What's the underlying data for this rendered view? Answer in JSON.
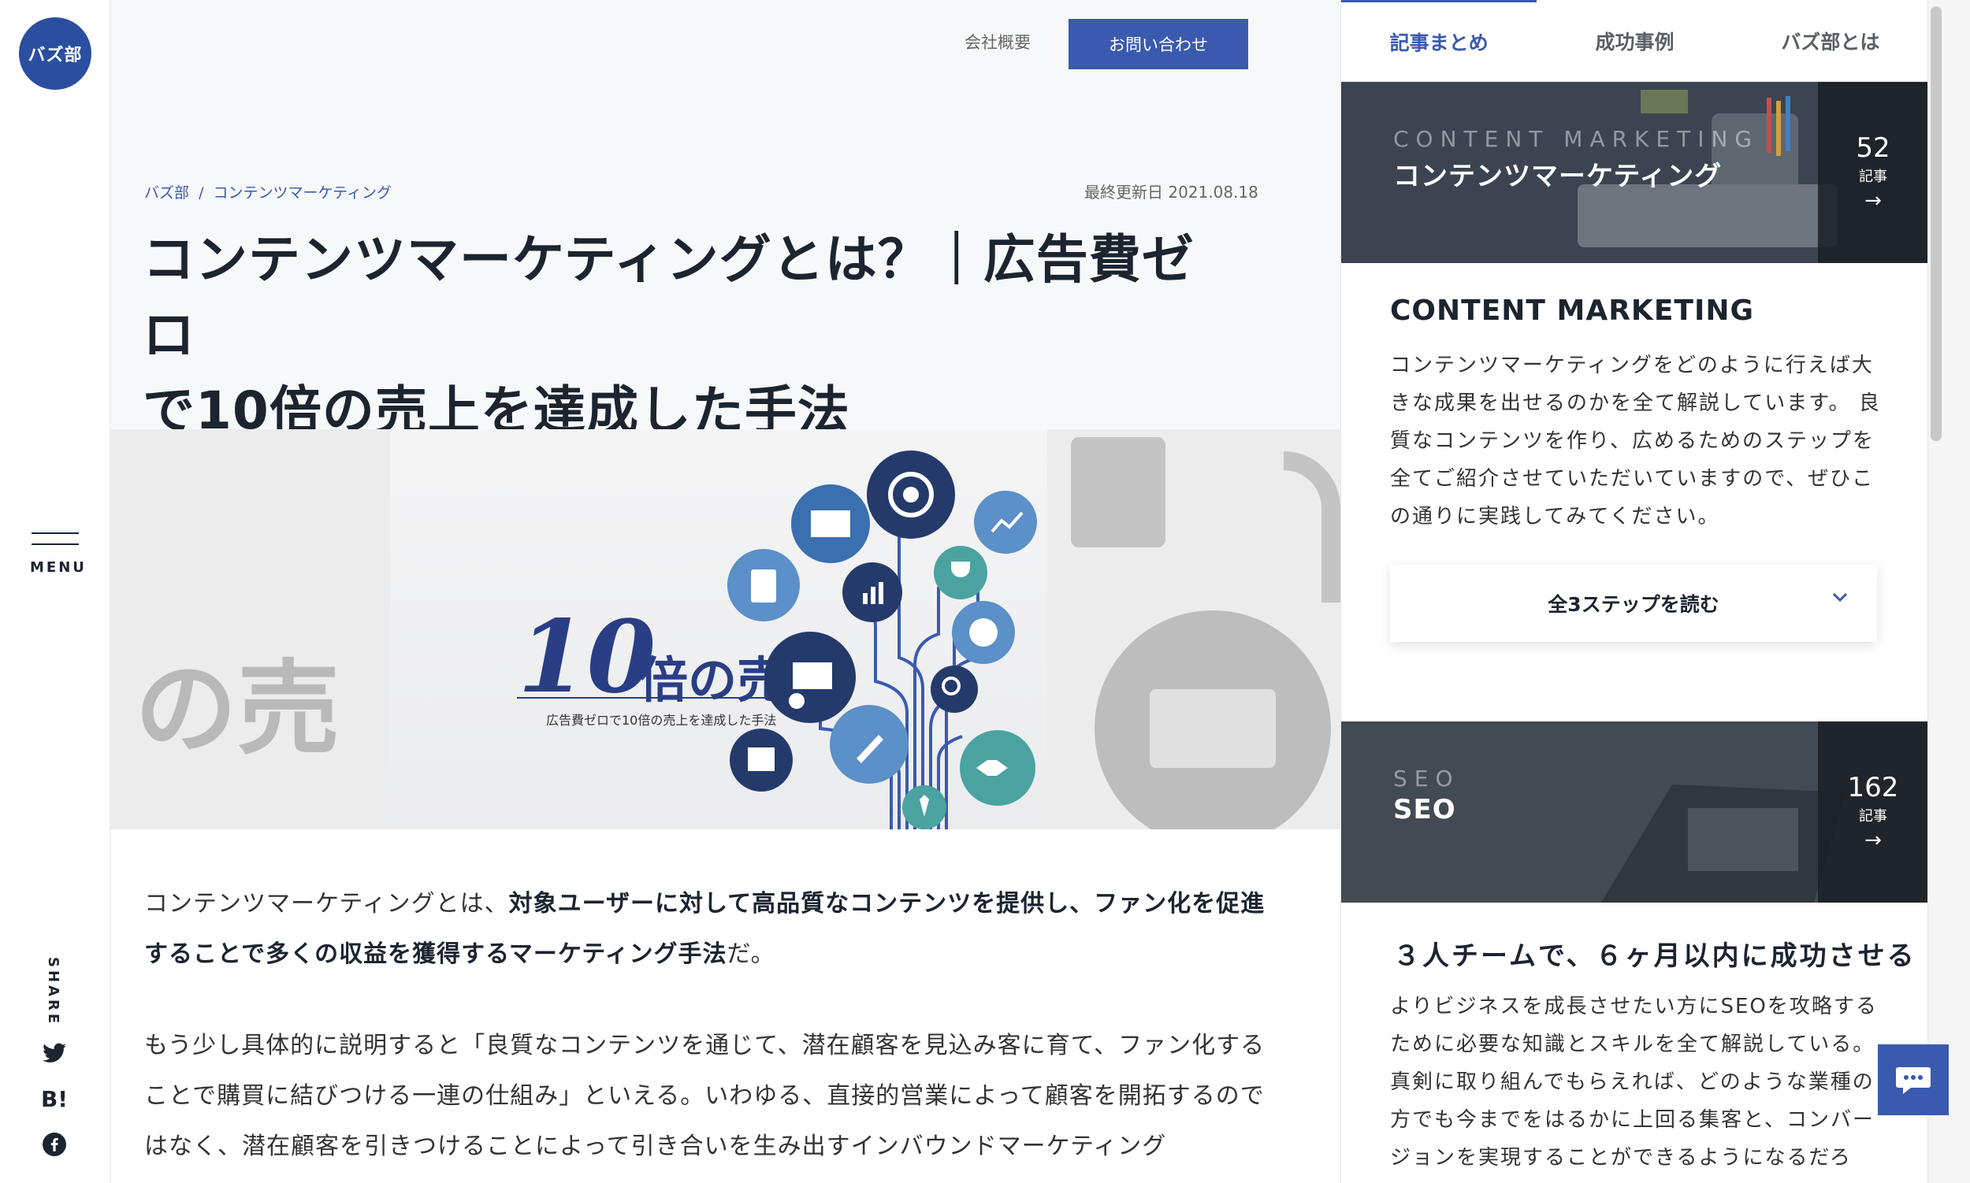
{
  "logo": {
    "text": "バズ部"
  },
  "left_rail": {
    "menu_label": "MENU",
    "share_label": "SHARE",
    "share_icons": [
      "twitter-icon",
      "hatena-bookmark-icon",
      "facebook-icon"
    ],
    "hatena_text": "B!"
  },
  "header": {
    "company_link": "会社概要",
    "contact_button": "お問い合わせ"
  },
  "breadcrumb": {
    "home": "バズ部",
    "separator": "/",
    "category": "コンテンツマーケティング"
  },
  "article": {
    "updated": "最終更新日 2021.08.18",
    "title_line1": "コンテンツマーケティングとは？｜広告費ゼロ",
    "title_line2": "で10倍の売上を達成した手法",
    "hero": {
      "big_number": "10",
      "big_text": "倍の売上",
      "caption": "広告費ゼロで10倍の売上を達成した手法",
      "ghost_text": "の売"
    },
    "para1_a": "コンテンツマーケティングとは、",
    "para1_b": "対象ユーザーに対して高品質なコンテンツを提供し、ファン化を促進することで多くの収益を獲得するマーケティング手法",
    "para1_c": "だ。",
    "para2": "もう少し具体的に説明すると「良質なコンテンツを通じて、潜在顧客を見込み客に育て、ファン化することで購買に結びつける一連の仕組み」といえる。いわゆる、直接的営業によって顧客を開拓するのではなく、潜在顧客を引きつけることによって引き合いを生み出すインバウンドマーケティング"
  },
  "sidebar": {
    "tabs": [
      {
        "label": "記事まとめ",
        "active": true
      },
      {
        "label": "成功事例",
        "active": false
      },
      {
        "label": "バズ部とは",
        "active": false
      }
    ],
    "category1": {
      "en": "CONTENT MARKETING",
      "ja": "コンテンツマーケティング",
      "count": "52",
      "unit": "記事",
      "arrow": "→"
    },
    "cat_heading": "CONTENT MARKETING",
    "cat_desc": "コンテンツマーケティングをどのように行えば大きな成果を出せるのかを全て解説しています。 良質なコンテンツを作り、広めるためのステップを全てご紹介させていただいていますので、ぜひこの通りに実践してみてください。",
    "read_button": "全3ステップを読む",
    "category2": {
      "en": "SEO",
      "ja": "SEO",
      "count": "162",
      "unit": "記事",
      "arrow": "→"
    },
    "seo_heading": "３人チームで、６ヶ月以内に成功させる",
    "seo_desc": "よりビジネスを成長させたい方にSEOを攻略するために必要な知識とスキルを全て解説している。真剣に取り組んでもらえれば、どのような業種の方でも今までをはるかに上回る集客と、コンバージョンを実現することができるようになるだろ"
  },
  "colors": {
    "brand_blue": "#3a5ab0",
    "logo_blue": "#2a4fa0",
    "text_dark": "#1c2430"
  }
}
